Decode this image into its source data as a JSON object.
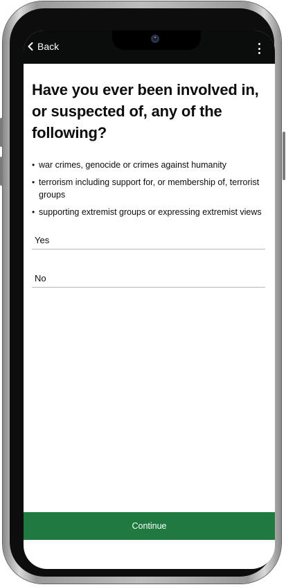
{
  "header": {
    "back_label": "Back"
  },
  "question": {
    "title": "Have you ever been involved in, or suspected of, any of the following?"
  },
  "bullets": [
    "war crimes, genocide or crimes against humanity",
    "terrorism including support for, or membership of, terrorist groups",
    "supporting extremist groups or expressing extremist views"
  ],
  "options": [
    "Yes",
    "No"
  ],
  "actions": {
    "continue_label": "Continue"
  },
  "colors": {
    "appbar": "#0b0c0c",
    "continue_button": "#1e7a3e",
    "text": "#0b0c0c"
  },
  "icons": {
    "back": "chevron-left-icon",
    "menu": "more-vertical-icon",
    "camera": "front-camera-icon"
  }
}
